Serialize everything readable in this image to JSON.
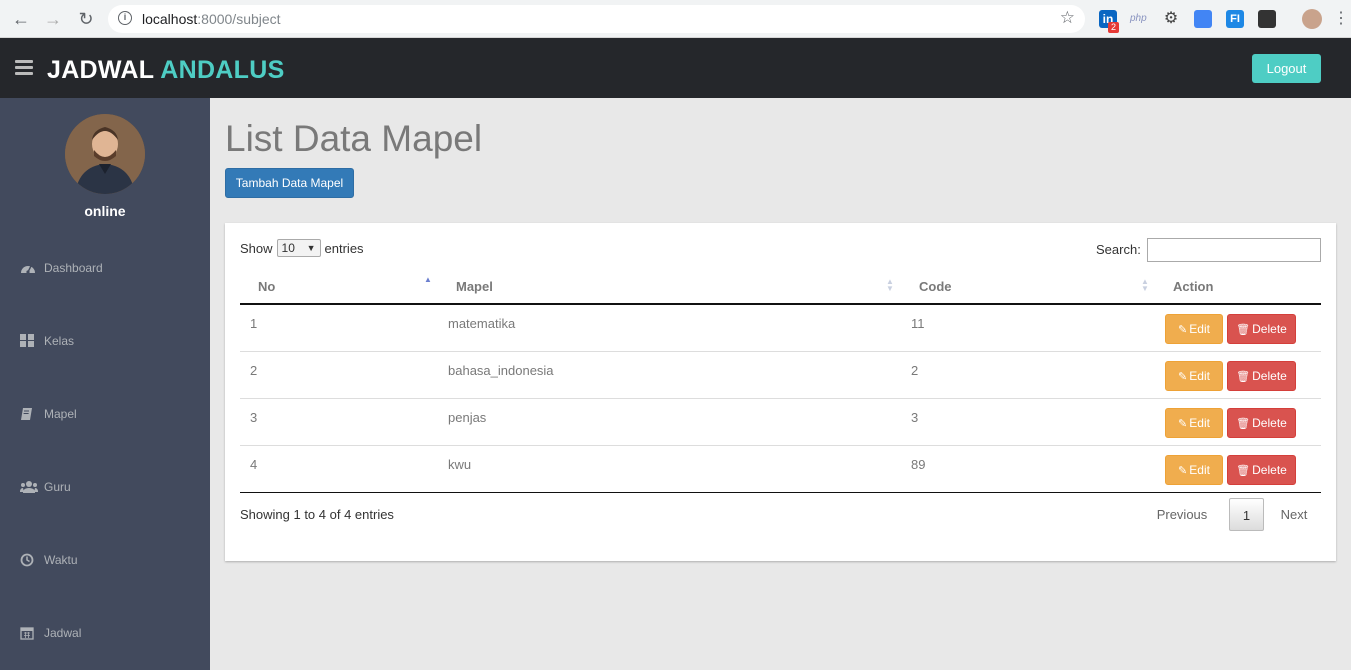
{
  "browser": {
    "url_host": "localhost",
    "url_path": ":8000/subject",
    "extension_badge": "2",
    "ext_php_label": "php"
  },
  "header": {
    "brand_main": "JADWAL",
    "brand_accent": "ANDALUS",
    "logout_label": "Logout"
  },
  "sidebar": {
    "status": "online",
    "items": [
      {
        "label": "Dashboard",
        "icon": "dashboard-icon"
      },
      {
        "label": "Kelas",
        "icon": "grid-icon"
      },
      {
        "label": "Mapel",
        "icon": "book-icon"
      },
      {
        "label": "Guru",
        "icon": "users-icon"
      },
      {
        "label": "Waktu",
        "icon": "clock-icon"
      },
      {
        "label": "Jadwal",
        "icon": "calendar-icon"
      }
    ]
  },
  "main": {
    "title": "List Data Mapel",
    "add_button": "Tambah Data Mapel",
    "show_label": "Show",
    "page_size": "10",
    "entries_label": "entries",
    "search_label": "Search:",
    "search_value": "",
    "columns": [
      "No",
      "Mapel",
      "Code",
      "Action"
    ],
    "rows": [
      {
        "no": "1",
        "mapel": "matematika",
        "code": "11"
      },
      {
        "no": "2",
        "mapel": "bahasa_indonesia",
        "code": "2"
      },
      {
        "no": "3",
        "mapel": "penjas",
        "code": "3"
      },
      {
        "no": "4",
        "mapel": "kwu",
        "code": "89"
      }
    ],
    "edit_label": "Edit",
    "delete_label": "Delete",
    "info": "Showing 1 to 4 of 4 entries",
    "pagination": {
      "previous": "Previous",
      "current": "1",
      "next": "Next"
    }
  },
  "colors": {
    "accent": "#4ecdc4",
    "header_bg": "#25272b",
    "sidebar_bg": "#424a5d",
    "primary": "#337ab7",
    "warning": "#f0ad4e",
    "danger": "#d9534f"
  }
}
